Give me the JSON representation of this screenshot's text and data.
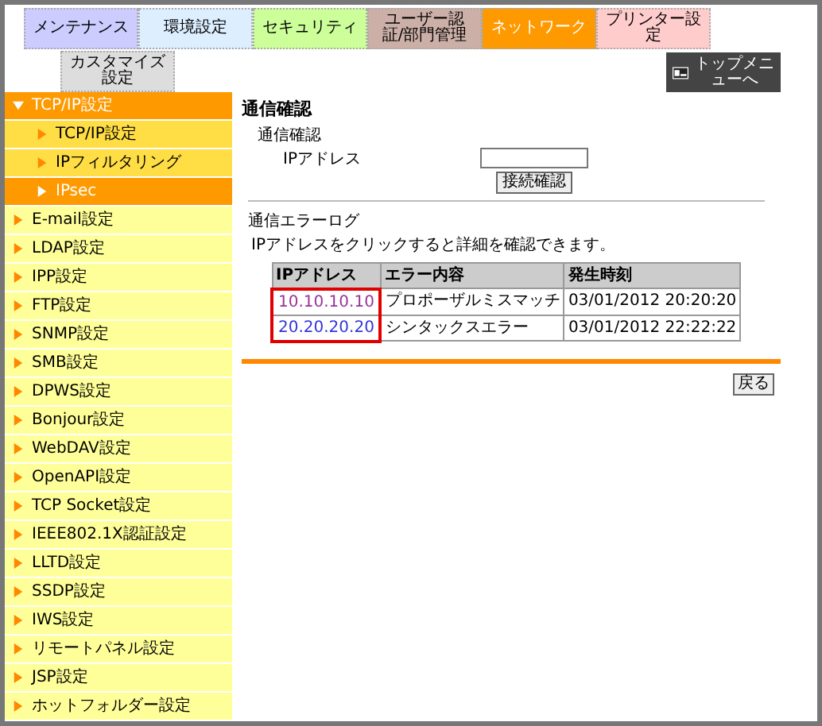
{
  "tabs": [
    {
      "label": "メンテナンス",
      "color": "#ccccff",
      "selected": false
    },
    {
      "label": "環境設定",
      "color": "#ddeeff",
      "selected": false
    },
    {
      "label": "セキュリティ",
      "color": "#ccff99",
      "selected": false
    },
    {
      "label": "ユーザー認証/部門管理",
      "color": "#ccb0a8",
      "selected": false
    },
    {
      "label": "ネットワーク",
      "color": "#ff9900",
      "selected": true
    },
    {
      "label": "プリンター設定",
      "color": "#ffcccc",
      "selected": false
    },
    {
      "label": "カスタマイズ設定",
      "color": "#dddddd",
      "selected": false
    }
  ],
  "top_menu_button": "トップメニューへ",
  "sidebar": {
    "items": [
      {
        "label": "TCP/IP設定",
        "expanded": true,
        "children": [
          {
            "label": "TCP/IP設定",
            "selected": false
          },
          {
            "label": "IPフィルタリング",
            "selected": false
          },
          {
            "label": "IPsec",
            "selected": true
          }
        ]
      },
      {
        "label": "E-mail設定",
        "expanded": false
      },
      {
        "label": "LDAP設定",
        "expanded": false
      },
      {
        "label": "IPP設定",
        "expanded": false
      },
      {
        "label": "FTP設定",
        "expanded": false
      },
      {
        "label": "SNMP設定",
        "expanded": false
      },
      {
        "label": "SMB設定",
        "expanded": false
      },
      {
        "label": "DPWS設定",
        "expanded": false
      },
      {
        "label": "Bonjour設定",
        "expanded": false
      },
      {
        "label": "WebDAV設定",
        "expanded": false
      },
      {
        "label": "OpenAPI設定",
        "expanded": false
      },
      {
        "label": "TCP Socket設定",
        "expanded": false
      },
      {
        "label": "IEEE802.1X認証設定",
        "expanded": false
      },
      {
        "label": "LLTD設定",
        "expanded": false
      },
      {
        "label": "SSDP設定",
        "expanded": false
      },
      {
        "label": "IWS設定",
        "expanded": false
      },
      {
        "label": "リモートパネル設定",
        "expanded": false
      },
      {
        "label": "JSP設定",
        "expanded": false
      },
      {
        "label": "ホットフォルダー設定",
        "expanded": false
      }
    ]
  },
  "content": {
    "title": "通信確認",
    "section": "通信確認",
    "ip_label": "IPアドレス",
    "connect_button": "接続確認",
    "log_title": "通信エラーログ",
    "log_hint": "IPアドレスをクリックすると詳細を確認できます。",
    "table": {
      "columns": [
        {
          "label": "IPアドレス",
          "highlighted": true
        },
        {
          "label": "エラー内容",
          "highlighted": false
        },
        {
          "label": "発生時刻",
          "highlighted": false
        }
      ],
      "rows": [
        {
          "ip": "10.10.10.10",
          "visited": true,
          "error": "プロポーザルミスマッチ",
          "time": "03/01/2012 20:20:20"
        },
        {
          "ip": "20.20.20.20",
          "visited": false,
          "error": "シンタックスエラー",
          "time": "03/01/2012 22:22:22"
        }
      ]
    },
    "back_button": "戻る"
  }
}
